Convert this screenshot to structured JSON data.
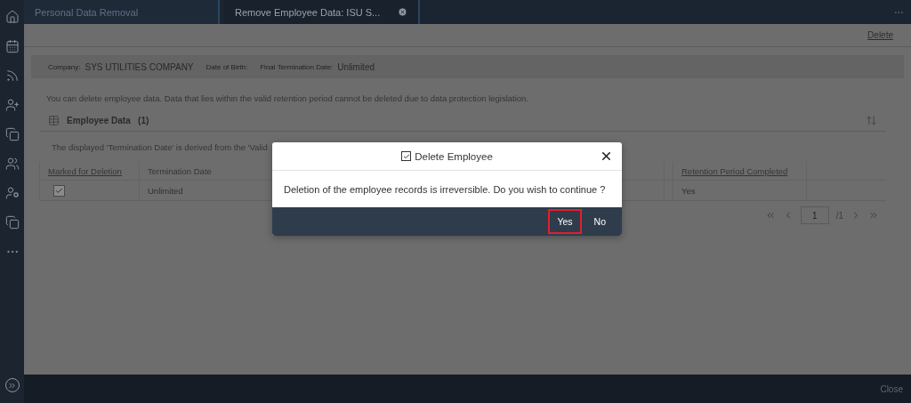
{
  "tabs": [
    {
      "label": "Personal Data Removal",
      "selected": false,
      "closable": false
    },
    {
      "label": "Remove Employee Data: ISU S...",
      "selected": true,
      "closable": true
    }
  ],
  "toolbar": {
    "action": "Delete"
  },
  "header_fields": [
    {
      "label": "Company:",
      "value": "SYS UTILITIES COMPANY"
    },
    {
      "label": "Date of Birth:"
    },
    {
      "label": "Final Termination Date:",
      "value": "Unlimited"
    }
  ],
  "info_text": "You can delete employee data. Data that lies within the valid retention period cannot be deleted due to data protection legislation.",
  "section": {
    "title": "Employee Data",
    "count": "(1)"
  },
  "note": "The displayed 'Termination Date' is derived from the 'Valid",
  "table": {
    "columns": [
      {
        "label": "Marked for Deletion",
        "link": true
      },
      {
        "label": "Termination Date",
        "link": false
      },
      {
        "label": "Retention Period Completed",
        "link": true
      }
    ],
    "rows": [
      {
        "checked": true,
        "cells": [
          "",
          "Unlimited",
          "Yes"
        ]
      }
    ]
  },
  "pagination": {
    "page": "1",
    "total": "/1"
  },
  "dialog": {
    "title": "Delete Employee",
    "message": "Deletion of the employee records is irreversible. Do you wish to continue ?",
    "buttons": [
      {
        "label": "Yes",
        "selected": true
      },
      {
        "label": "No",
        "selected": false
      }
    ]
  },
  "footer": {
    "action": "Close"
  }
}
